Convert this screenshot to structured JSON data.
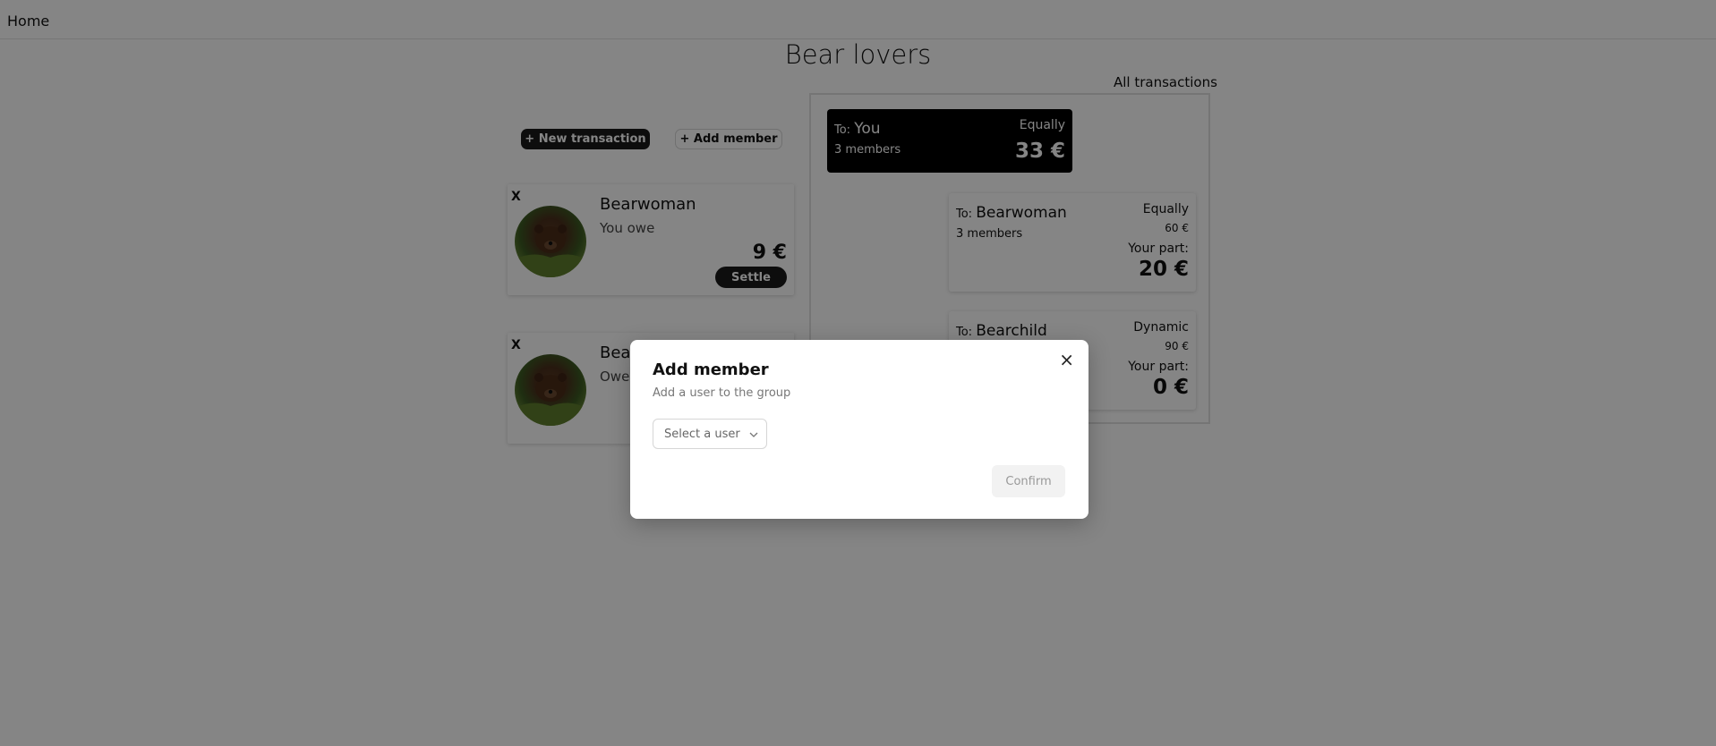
{
  "nav": {
    "home": "Home"
  },
  "page": {
    "title": "Bear lovers"
  },
  "actions": {
    "new_transaction": "+ New transaction",
    "add_member": "+ Add member"
  },
  "members": [
    {
      "remove": "X",
      "name": "Bearwoman",
      "status": "You owe",
      "amount": "9 €",
      "settle": "Settle"
    },
    {
      "remove": "X",
      "name": "Bear",
      "status": "Owes"
    }
  ],
  "transactions": {
    "link": "All transactions",
    "items": [
      {
        "to_label": "To:",
        "to_name": "You",
        "members": "3 members",
        "split": "Equally",
        "amount": "33 €"
      },
      {
        "to_label": "To:",
        "to_name": "Bearwoman",
        "members": "3 members",
        "split": "Equally",
        "total": "60 €",
        "your_part_label": "Your part:",
        "your_part": "20 €"
      },
      {
        "to_label": "To:",
        "to_name": "Bearchild",
        "split": "Dynamic",
        "total": "90 €",
        "your_part_label": "Your part:",
        "your_part": "0 €"
      }
    ]
  },
  "modal": {
    "title": "Add member",
    "description": "Add a user to the group",
    "select_placeholder": "Select a user",
    "confirm": "Confirm",
    "close": "×"
  },
  "colors": {
    "overlay": "#000000",
    "primary_button": "#1a1a1a",
    "card_dark": "#000000"
  },
  "icons": {
    "close": "close-icon",
    "chevron": "chevron-down-icon"
  }
}
